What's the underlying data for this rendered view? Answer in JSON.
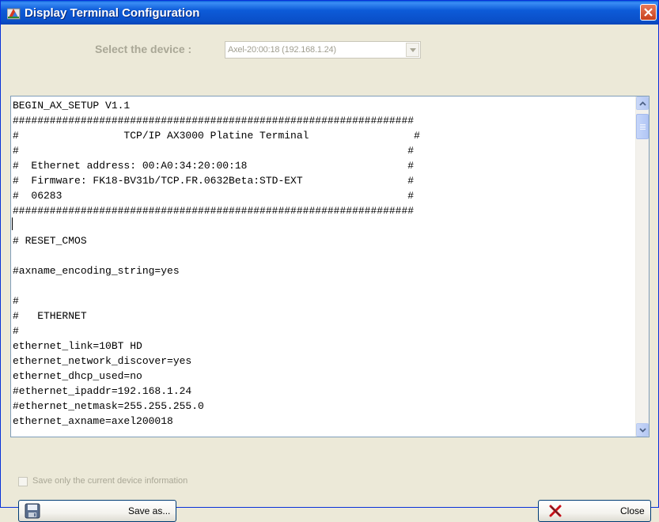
{
  "window": {
    "title": "Display Terminal Configuration",
    "accent_color": "#0a5fdb"
  },
  "device_select": {
    "label": "Select the device :",
    "selected_value": "Axel-20:00:18 (192.168.1.24)"
  },
  "editor": {
    "lines": [
      "BEGIN_AX_SETUP V1.1",
      "#################################################################",
      "#                 TCP/IP AX3000 Platine Terminal                 #",
      "#                                                               #",
      "#  Ethernet address: 00:A0:34:20:00:18                          #",
      "#  Firmware: FK18-BV31b/TCP.FR.0632Beta:STD-EXT                 #",
      "#  06283                                                        #",
      "#################################################################",
      "",
      "# RESET_CMOS",
      "",
      "#axname_encoding_string=yes",
      "",
      "#",
      "#   ETHERNET",
      "#",
      "ethernet_link=10BT HD",
      "ethernet_network_discover=yes",
      "ethernet_dhcp_used=no",
      "#ethernet_ipaddr=192.168.1.24",
      "#ethernet_netmask=255.255.255.0",
      "ethernet_axname=axel200018"
    ]
  },
  "options": {
    "save_current_only_label": "Save only the current device information",
    "save_current_only_checked": false
  },
  "buttons": {
    "save_as_label": "Save as...",
    "close_label": "Close"
  }
}
